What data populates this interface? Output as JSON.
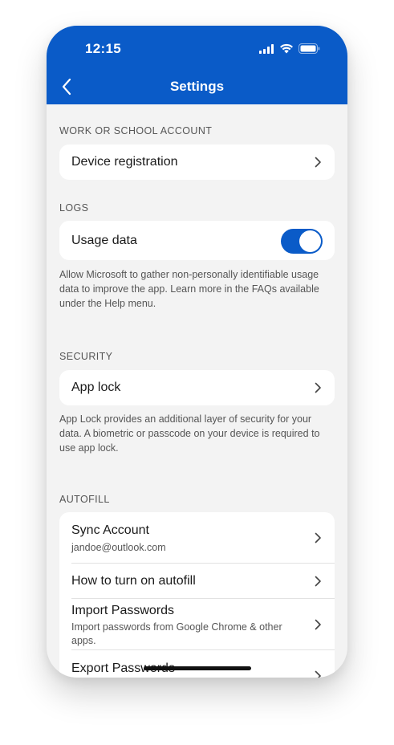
{
  "status": {
    "time": "12:15"
  },
  "header": {
    "title": "Settings"
  },
  "sections": {
    "work": {
      "label": "WORK OR SCHOOL ACCOUNT",
      "device_registration": "Device registration"
    },
    "logs": {
      "label": "LOGS",
      "usage_data": "Usage data",
      "usage_data_enabled": true,
      "description": "Allow Microsoft to gather non-personally identifiable usage data to improve the app. Learn more in the FAQs available under the Help menu."
    },
    "security": {
      "label": "SECURITY",
      "app_lock": "App lock",
      "description": "App Lock provides an additional layer of security for your data. A biometric or passcode on your device is required to use app lock."
    },
    "autofill": {
      "label": "AUTOFILL",
      "sync_account": "Sync Account",
      "sync_account_email": "jandoe@outlook.com",
      "how_to": "How to turn on autofill",
      "import": "Import Passwords",
      "import_sub": "Import passwords from Google Chrome & other apps.",
      "export": "Export Passwords"
    }
  },
  "colors": {
    "accent": "#0a5bc8",
    "background": "#f3f3f3"
  }
}
